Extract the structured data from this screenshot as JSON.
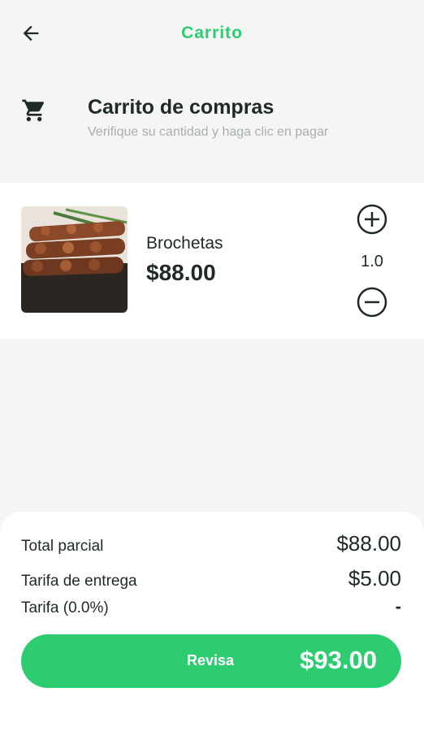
{
  "appbar": {
    "title": "Carrito",
    "back_icon": "arrow-left-icon"
  },
  "header": {
    "icon": "shopping-cart-icon",
    "title": "Carrito de compras",
    "subtitle": "Verifique su cantidad y haga clic en pagar"
  },
  "items": [
    {
      "name": "Brochetas",
      "price": "$88.00",
      "quantity": "1.0"
    }
  ],
  "summary": {
    "subtotal_label": "Total parcial",
    "subtotal_value": "$88.00",
    "delivery_label": "Tarifa de entrega",
    "delivery_value": "$5.00",
    "fee_label": "Tarifa (0.0%)",
    "fee_value": "-"
  },
  "checkout": {
    "label": "Revisa",
    "total": "$93.00"
  },
  "colors": {
    "accent": "#2ecc71",
    "text": "#1f2a24",
    "muted": "#a9aeb0"
  }
}
